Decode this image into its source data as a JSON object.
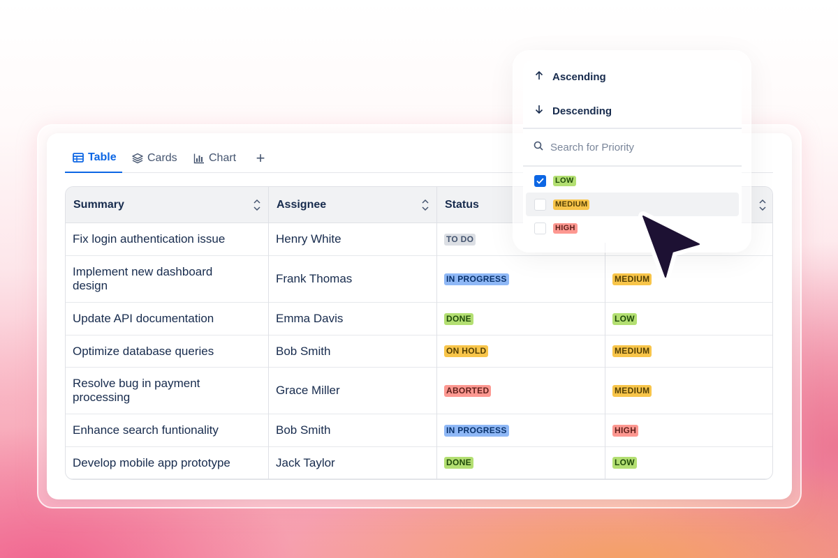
{
  "tabs": [
    {
      "label": "Table",
      "icon": "table-icon",
      "active": true
    },
    {
      "label": "Cards",
      "icon": "layers-icon",
      "active": false
    },
    {
      "label": "Chart",
      "icon": "bar-chart-icon",
      "active": false
    },
    {
      "label": "+",
      "icon": "plus-icon",
      "active": false
    }
  ],
  "table": {
    "columns": [
      "Summary",
      "Assignee",
      "Status",
      ""
    ],
    "rows": [
      {
        "summary": "Fix login authentication issue",
        "assignee": "Henry White",
        "status": "TO DO",
        "priority": ""
      },
      {
        "summary": "Implement new dashboard design",
        "assignee": "Frank Thomas",
        "status": "IN PROGRESS",
        "priority": "MEDIUM"
      },
      {
        "summary": "Update API documentation",
        "assignee": "Emma Davis",
        "status": "DONE",
        "priority": "LOW"
      },
      {
        "summary": "Optimize database queries",
        "assignee": "Bob Smith",
        "status": "ON HOLD",
        "priority": "MEDIUM"
      },
      {
        "summary": "Resolve bug in payment processing",
        "assignee": "Grace Miller",
        "status": "ABORTED",
        "priority": "MEDIUM"
      },
      {
        "summary": "Enhance search funtionality",
        "assignee": "Bob Smith",
        "status": "IN PROGRESS",
        "priority": "HIGH"
      },
      {
        "summary": "Develop mobile app prototype",
        "assignee": "Jack Taylor",
        "status": "DONE",
        "priority": "LOW"
      }
    ]
  },
  "dropdown": {
    "ascending": "Ascending",
    "descending": "Descending",
    "search_placeholder": "Search for Priority",
    "options": [
      {
        "label": "LOW",
        "checked": true
      },
      {
        "label": "MEDIUM",
        "checked": false
      },
      {
        "label": "HIGH",
        "checked": false
      }
    ]
  },
  "lozenge_colors": {
    "TO DO": {
      "bg": "#dcdfe4",
      "fg": "#44546f"
    },
    "IN PROGRESS": {
      "bg": "#8fb8f6",
      "fg": "#09326c"
    },
    "DONE": {
      "bg": "#b3df72",
      "fg": "#1f4a0a"
    },
    "ON HOLD": {
      "bg": "#f8c54a",
      "fg": "#533f04"
    },
    "ABORTED": {
      "bg": "#fd9891",
      "fg": "#5d1f1a"
    },
    "MEDIUM": {
      "bg": "#f8c54a",
      "fg": "#533f04"
    },
    "LOW": {
      "bg": "#b3df72",
      "fg": "#1f4a0a"
    },
    "HIGH": {
      "bg": "#fd9891",
      "fg": "#5d1f1a"
    }
  },
  "colors": {
    "accent": "#0c66e4"
  }
}
